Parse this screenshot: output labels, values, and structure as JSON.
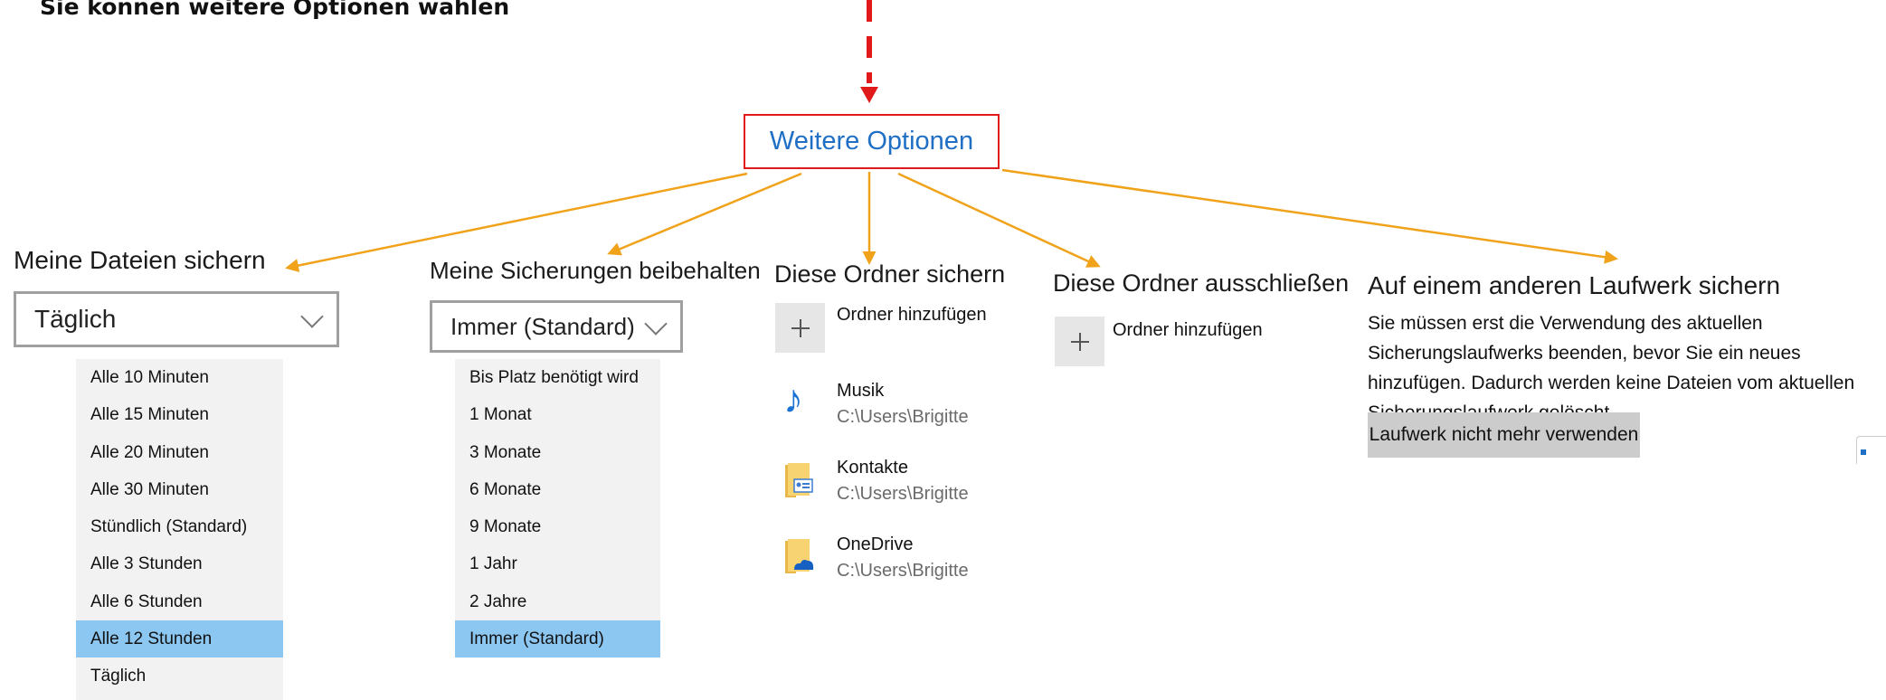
{
  "caption": "Sie können weitere Optionen wählen",
  "more_options_link": "Weitere Optionen",
  "col1": {
    "title": "Meine Dateien sichern",
    "selected": "Täglich",
    "options": [
      "Alle 10 Minuten",
      "Alle 15 Minuten",
      "Alle 20 Minuten",
      "Alle 30 Minuten",
      "Stündlich (Standard)",
      "Alle 3 Stunden",
      "Alle 6 Stunden",
      "Alle 12 Stunden",
      "Täglich"
    ],
    "highlighted": "Alle 12 Stunden"
  },
  "col2": {
    "title": "Meine Sicherungen beibehalten",
    "selected": "Immer (Standard)",
    "options": [
      "Bis Platz benötigt wird",
      "1 Monat",
      "3 Monate",
      "6 Monate",
      "9 Monate",
      "1 Jahr",
      "2 Jahre",
      "Immer (Standard)"
    ],
    "highlighted": "Immer (Standard)"
  },
  "col3": {
    "title": "Diese Ordner sichern",
    "add_label": "Ordner hinzufügen",
    "folders": [
      {
        "name": "Musik",
        "path": "C:\\Users\\Brigitte",
        "icon": "music-note-icon"
      },
      {
        "name": "Kontakte",
        "path": "C:\\Users\\Brigitte",
        "icon": "contacts-folder-icon"
      },
      {
        "name": "OneDrive",
        "path": "C:\\Users\\Brigitte",
        "icon": "onedrive-folder-icon"
      }
    ]
  },
  "col4": {
    "title": "Diese Ordner ausschließen",
    "add_label": "Ordner hinzufügen"
  },
  "col5": {
    "title": "Auf einem anderen Laufwerk sichern",
    "description": "Sie müssen erst die Verwendung des aktuellen Sicherungslaufwerks beenden, bevor Sie ein neues hinzufügen. Dadurch werden keine Dateien vom aktuellen Sicherungslaufwerk gelöscht.",
    "button": "Laufwerk nicht mehr verwenden"
  },
  "colors": {
    "arrow_orange": "#f0a21a",
    "arrow_red": "#e01a1a",
    "link_blue": "#1f6fc5",
    "selection_blue": "#8cc7f2"
  }
}
